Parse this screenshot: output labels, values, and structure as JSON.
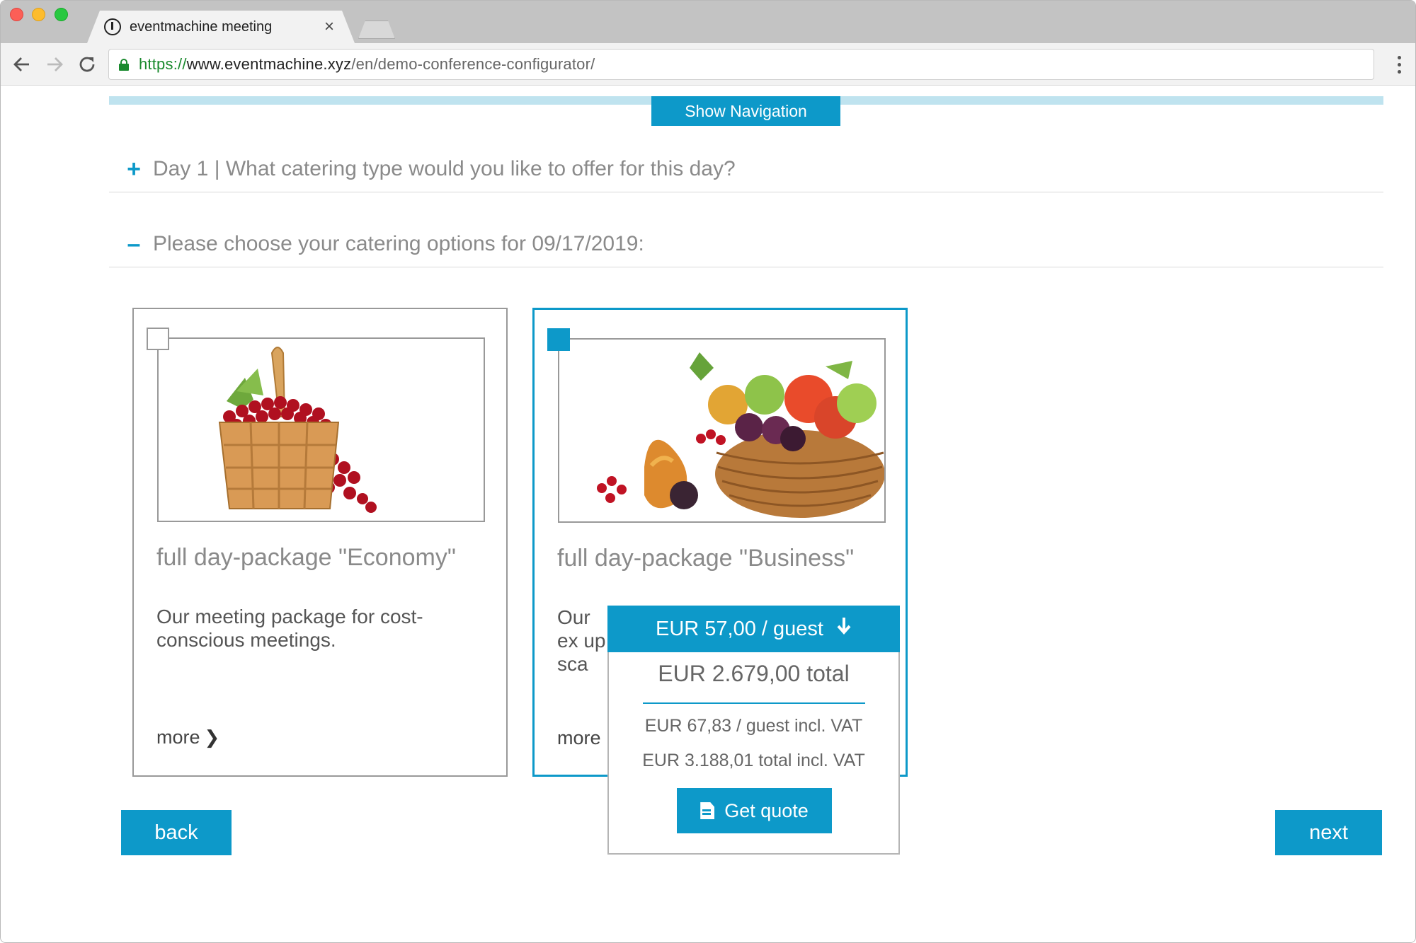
{
  "browser": {
    "tab_title": "eventmachine meeting",
    "tab_close": "×",
    "url_scheme": "https://",
    "url_host": "www.eventmachine.xyz",
    "url_path": "/en/demo-conference-configurator/"
  },
  "header": {
    "show_navigation": "Show Navigation"
  },
  "accordion": [
    {
      "sign": "+",
      "text": "Day 1 | What catering type would you like to offer for this day?"
    },
    {
      "sign": "–",
      "text": "Please choose your catering options for 09/17/2019:"
    }
  ],
  "packages": [
    {
      "title": "full day-package \"Economy\"",
      "description": "Our meeting package for cost-conscious meetings.",
      "more": "more",
      "selected": false,
      "image": "basket-of-red-currants"
    },
    {
      "title": "full day-package \"Business\"",
      "description": "Our ex upsca",
      "more": "more",
      "selected": true,
      "image": "basket-of-mixed-fruit"
    }
  ],
  "price_popup": {
    "per_guest": "EUR 57,00 / guest",
    "total": "EUR 2.679,00 total",
    "per_guest_vat": "EUR 67,83 / guest incl. VAT",
    "total_vat": "EUR 3.188,01 total incl. VAT",
    "quote_button": "Get quote"
  },
  "footer": {
    "back": "back",
    "next": "next"
  },
  "colors": {
    "accent": "#0d99c9",
    "progress": "#bfe3ef",
    "secure": "#1a8a2e"
  }
}
